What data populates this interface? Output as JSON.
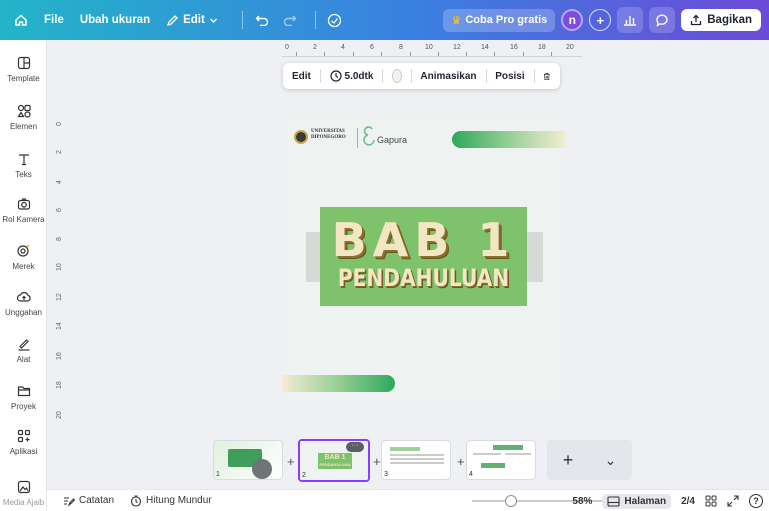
{
  "topbar": {
    "file": "File",
    "resize": "Ubah ukuran",
    "edit": "Edit",
    "pro": "Coba Pro gratis",
    "avatar_initial": "n",
    "plus": "+",
    "share": "Bagikan",
    "pro_star_color": "#ffc233",
    "gradient_start": "#23b4c9",
    "gradient_end": "#6d4ad8"
  },
  "sidebar": {
    "items": [
      {
        "label": "Template",
        "icon": "template-icon"
      },
      {
        "label": "Elemen",
        "icon": "elements-icon"
      },
      {
        "label": "Teks",
        "icon": "text-icon"
      },
      {
        "label": "Rol Kamera",
        "icon": "camera-icon"
      },
      {
        "label": "Merek",
        "icon": "brand-icon"
      },
      {
        "label": "Unggahan",
        "icon": "upload-icon"
      },
      {
        "label": "Alat",
        "icon": "draw-icon"
      },
      {
        "label": "Proyek",
        "icon": "folder-icon"
      },
      {
        "label": "Aplikasi",
        "icon": "apps-icon"
      },
      {
        "label": "Media Ajaib",
        "icon": "magic-media-icon"
      }
    ]
  },
  "rulers": {
    "horizontal": [
      "0",
      "2",
      "4",
      "6",
      "8",
      "10",
      "12",
      "14",
      "16",
      "18",
      "20"
    ],
    "vertical": [
      "0",
      "2",
      "4",
      "6",
      "8",
      "10",
      "12",
      "14",
      "16",
      "18",
      "20"
    ]
  },
  "floating_toolbar": {
    "edit": "Edit",
    "duration": "5.0dtk",
    "animate": "Animasikan",
    "position": "Posisi"
  },
  "slide": {
    "university_line1": "UNIVERSITAS",
    "university_line2": "DIPONEGORO",
    "brand": "Gapura",
    "title_main": "BAB 1",
    "title_sub": "PENDAHULUAN",
    "accent_green": "#7ec26c",
    "title_color": "#f3e6c3"
  },
  "thumbnails": [
    {
      "number": "1"
    },
    {
      "number": "2",
      "selected": true,
      "title": "BAB 1",
      "subtitle": "PENDAHULUAN"
    },
    {
      "number": "3"
    },
    {
      "number": "4"
    }
  ],
  "add_page": {
    "plus": "+",
    "chevron": "⌄"
  },
  "bottombar": {
    "notes": "Catatan",
    "timer": "Hitung Mundur",
    "zoom": "58%",
    "zoom_level": 0.27,
    "pages": "Halaman",
    "page_count": "2/4",
    "help": "?"
  }
}
